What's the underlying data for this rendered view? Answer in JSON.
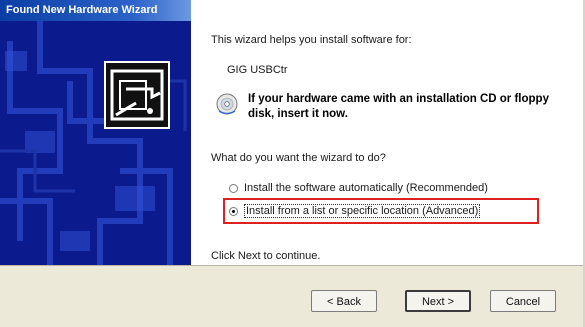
{
  "window": {
    "title": "Found New Hardware Wizard"
  },
  "content": {
    "intro": "This wizard helps you install software for:",
    "device_name": "GIG USBCtr",
    "cd_prompt": "If your hardware came with an installation CD or floppy disk, insert it now.",
    "question": "What do you want the wizard to do?",
    "options": [
      {
        "label": "Install the software automatically (Recommended)",
        "selected": false
      },
      {
        "label": "Install from a list or specific location (Advanced)",
        "selected": true
      }
    ],
    "continue_text": "Click Next to continue."
  },
  "buttons": {
    "back": "< Back",
    "next": "Next >",
    "cancel": "Cancel"
  },
  "colors": {
    "titlebar": "#0a3ea4",
    "banner": "#0b1a8c",
    "highlight": "#e0201f",
    "footer": "#ece9d8"
  },
  "icons": [
    "hardware-wizard-logo-icon",
    "cd-disk-icon"
  ]
}
